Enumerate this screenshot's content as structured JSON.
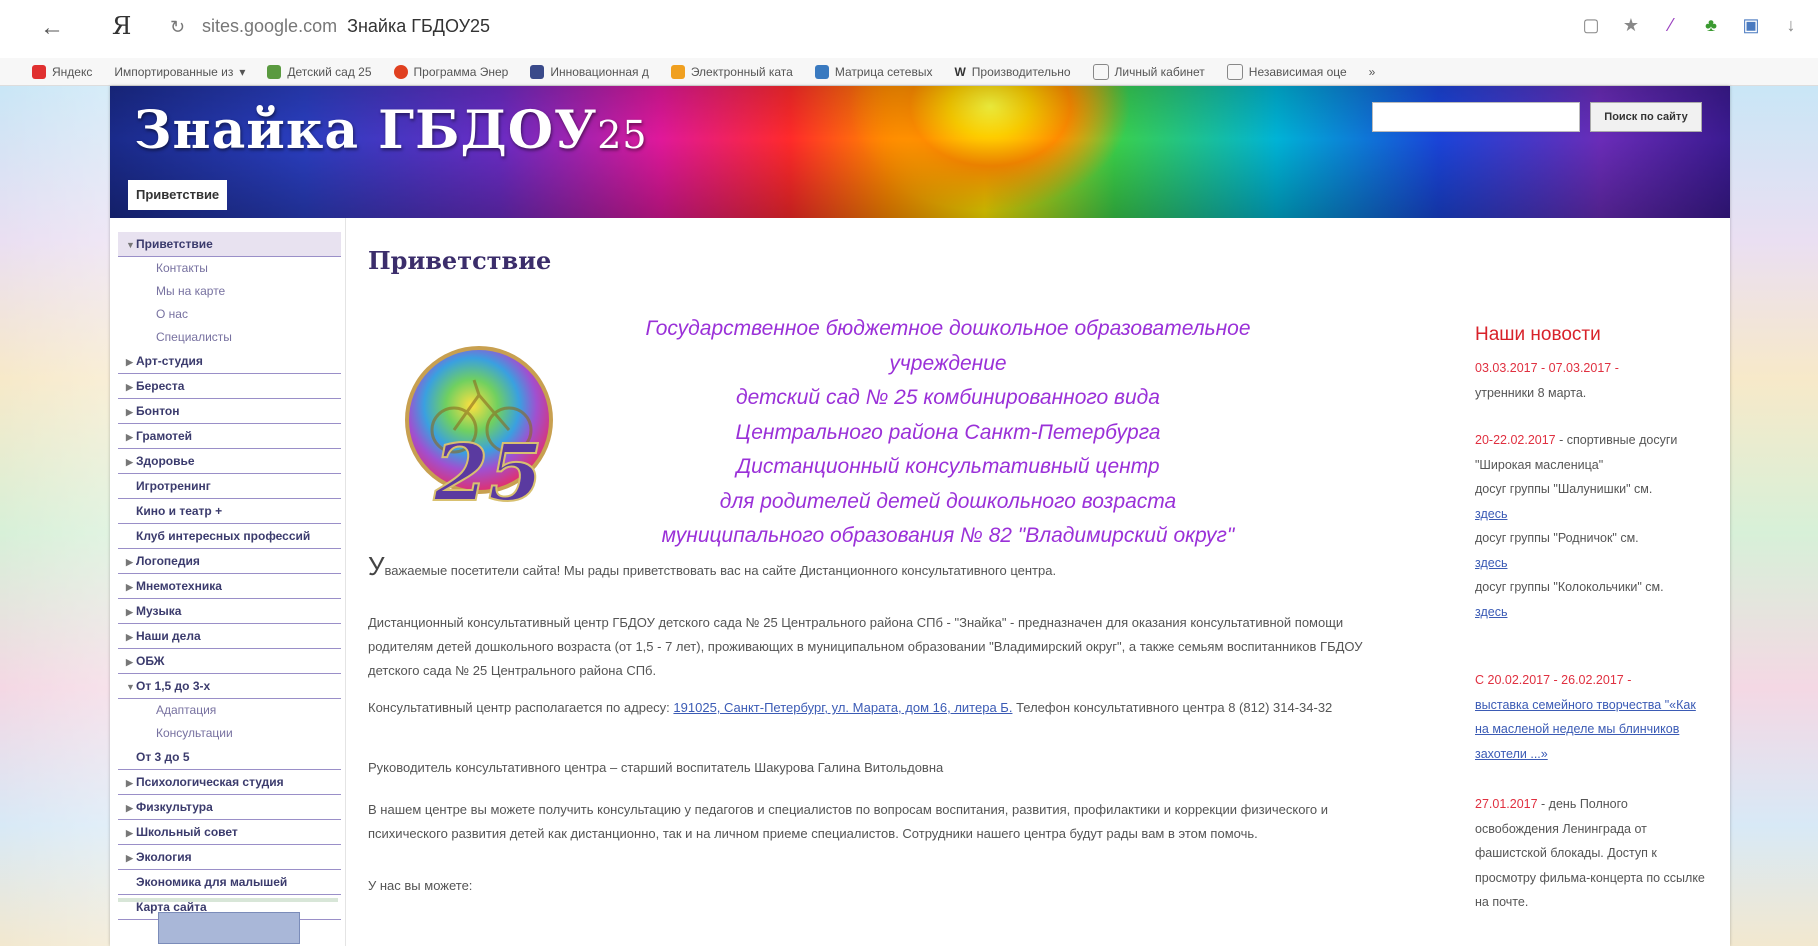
{
  "browser": {
    "url_domain": "sites.google.com",
    "page_title": "Знайка ГБДОУ25",
    "bookmarks": [
      "Яндекс",
      "Импортированные из",
      "Детский сад 25",
      "Программа Энер",
      "Инновационная д",
      "Электронный ката",
      "Матрица сетевых",
      "Производительно",
      "Личный кабинет",
      "Независимая оце"
    ],
    "more": "»"
  },
  "site": {
    "title_main": "Знайка ГБДОУ",
    "title_num": "25",
    "search_button": "Поиск по сайту",
    "header_tab": "Приветствие"
  },
  "sidebar": {
    "items": [
      {
        "label": "Приветствие",
        "arrow": "▼"
      },
      {
        "label": "Контакты"
      },
      {
        "label": "Мы на карте"
      },
      {
        "label": "О нас"
      },
      {
        "label": "Специалисты"
      },
      {
        "label": "Арт-студия",
        "arrow": "▶"
      },
      {
        "label": "Береста",
        "arrow": "▶"
      },
      {
        "label": "Бонтон",
        "arrow": "▶"
      },
      {
        "label": "Грамотей",
        "arrow": "▶"
      },
      {
        "label": "Здоровье",
        "arrow": "▶"
      },
      {
        "label": "Игротренинг"
      },
      {
        "label": "Кино и театр +"
      },
      {
        "label": "Клуб интересных профессий"
      },
      {
        "label": "Логопедия",
        "arrow": "▶"
      },
      {
        "label": "Мнемотехника",
        "arrow": "▶"
      },
      {
        "label": "Музыка",
        "arrow": "▶"
      },
      {
        "label": "Наши дела",
        "arrow": "▶"
      },
      {
        "label": "ОБЖ",
        "arrow": "▶"
      },
      {
        "label": "От 1,5 до 3-х",
        "arrow": "▼"
      },
      {
        "label": "Адаптация"
      },
      {
        "label": "Консультации"
      },
      {
        "label": "От 3 до 5"
      },
      {
        "label": "Психологическая студия",
        "arrow": "▶"
      },
      {
        "label": "Физкультура",
        "arrow": "▶"
      },
      {
        "label": "Школьный совет",
        "arrow": "▶"
      },
      {
        "label": "Экология",
        "arrow": "▶"
      },
      {
        "label": "Экономика для малышей"
      },
      {
        "label": "Карта сайта"
      }
    ]
  },
  "main": {
    "title": "Приветствие",
    "logo_number": "25",
    "intro_lines": [
      "Государственное бюджетное дошкольное образовательное учреждение",
      "детский сад № 25 комбинированного вида",
      "Центрального района Санкт-Петербурга",
      "Дистанционный консультативный центр",
      "для родителей детей дошкольного возраста",
      "муниципального образования № 82 \"Владимирский округ\""
    ],
    "welcome_first_letter": "У",
    "welcome_rest": "важаемые посетители сайта! Мы рады приветствовать вас на сайте Дистанционного консультативного центра.",
    "p1": "Дистанционный консультативный центр ГБДОУ детского сада № 25 Центрального района СПб - \"Знайка\" - предназначен для оказания консультативной помощи родителям детей дошкольного возраста (от 1,5 - 7 лет), проживающих в муниципальном образовании \"Владимирский округ\", а также семьям воспитанников ГБДОУ детского сада № 25 Центрального района СПб.",
    "p2_before": "Консультативный центр располагается по адресу:",
    "p2_link": "191025, Санкт-Петербург, ул. Марата, дом 16, литера Б.",
    "p2_after": "Телефон консультативного центра 8 (812) 314-34-32",
    "p3": "Руководитель консультативного центра – старший воспитатель Шакурова Галина Витольдовна",
    "p4": "В нашем центре вы можете получить консультацию у педагогов и специалистов по вопросам воспитания, развития, профилактики и коррекции физического и психического развития детей как дистанционно, так и на личном приеме специалистов. Сотрудники нашего центра будут рады вам в этом помочь.",
    "p5": "У нас вы можете:"
  },
  "news": {
    "title": "Наши новости",
    "n1_date": "03.03.2017 - 07.03.2017 -",
    "n1_text": "утренники 8 марта.",
    "n2_date": "20-22.02.2017",
    "n2_text": "- спортивные досуги \"Широкая масленица\"",
    "n2_l1": "досуг группы \"Шалунишки\" см.",
    "n2_a1": "здесь",
    "n2_l2": "досуг группы \"Родничок\" см.",
    "n2_a2": "здесь",
    "n2_l3": "досуг группы \"Колокольчики\" см.",
    "n2_a3": "здесь",
    "n3_date": "С 20.02.2017 - 26.02.2017 -",
    "n3_link": "выставка семейного творчества \"«Как на масленой неделе мы блинчиков захотели ...»",
    "n4_date": "27.01.2017",
    "n4_text": "- день Полного освобождения Ленинграда от фашистской блокады. Доступ к просмотру фильма-концерта по ссылке на почте."
  },
  "colors": {
    "title_purple": "#3b2d6b",
    "intro_violet": "#9a30d8",
    "news_red": "#d8222a",
    "link_blue": "#3b5bb5"
  }
}
